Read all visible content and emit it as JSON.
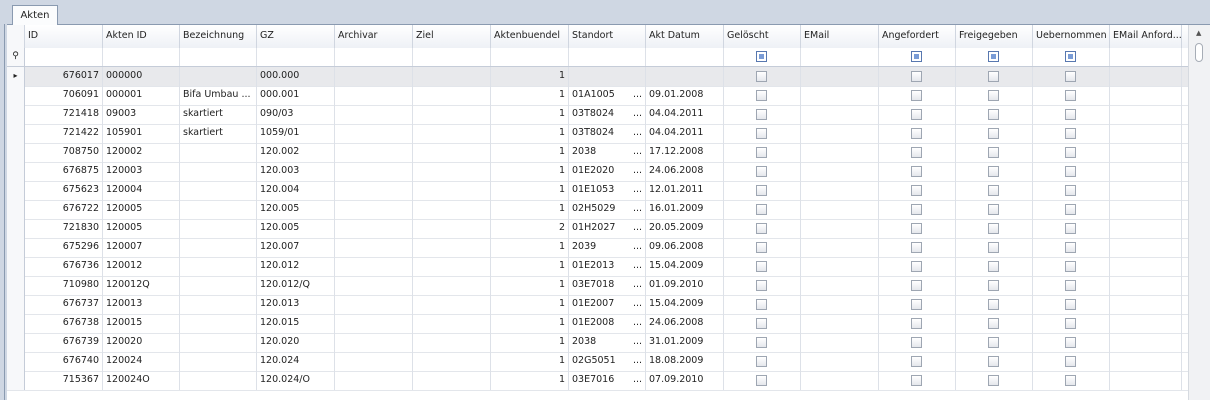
{
  "tab": {
    "label": "Akten"
  },
  "columns": [
    "ID",
    "Akten ID",
    "Bezeichnung",
    "GZ",
    "Archivar",
    "Ziel",
    "Aktenbuendel",
    "Standort",
    "Akt Datum",
    "Gelöscht",
    "EMail",
    "Angefordert",
    "Freigegeben",
    "Uebernommen",
    "EMail Anford..."
  ],
  "rows": [
    {
      "id": "676017",
      "akten_id": "000000",
      "bezeichnung": "",
      "gz": "000.000",
      "buendel": "1",
      "standort": "",
      "datum": ""
    },
    {
      "id": "706091",
      "akten_id": "000001",
      "bezeichnung": "Bifa Umbau ...",
      "gz": "000.001",
      "buendel": "1",
      "standort": "01A1005",
      "datum": "09.01.2008"
    },
    {
      "id": "721418",
      "akten_id": "09003",
      "bezeichnung": "skartiert",
      "gz": "090/03",
      "buendel": "1",
      "standort": "03T8024",
      "datum": "04.04.2011"
    },
    {
      "id": "721422",
      "akten_id": "105901",
      "bezeichnung": "skartiert",
      "gz": "1059/01",
      "buendel": "1",
      "standort": "03T8024",
      "datum": "04.04.2011"
    },
    {
      "id": "708750",
      "akten_id": "120002",
      "bezeichnung": "",
      "gz": "120.002",
      "buendel": "1",
      "standort": "2038",
      "datum": "17.12.2008"
    },
    {
      "id": "676875",
      "akten_id": "120003",
      "bezeichnung": "",
      "gz": "120.003",
      "buendel": "1",
      "standort": "01E2020",
      "datum": "24.06.2008"
    },
    {
      "id": "675623",
      "akten_id": "120004",
      "bezeichnung": "",
      "gz": "120.004",
      "buendel": "1",
      "standort": "01E1053",
      "datum": "12.01.2011"
    },
    {
      "id": "676722",
      "akten_id": "120005",
      "bezeichnung": "",
      "gz": "120.005",
      "buendel": "1",
      "standort": "02H5029",
      "datum": "16.01.2009"
    },
    {
      "id": "721830",
      "akten_id": "120005",
      "bezeichnung": "",
      "gz": "120.005",
      "buendel": "2",
      "standort": "01H2027",
      "datum": "20.05.2009"
    },
    {
      "id": "675296",
      "akten_id": "120007",
      "bezeichnung": "",
      "gz": "120.007",
      "buendel": "1",
      "standort": "2039",
      "datum": "09.06.2008"
    },
    {
      "id": "676736",
      "akten_id": "120012",
      "bezeichnung": "",
      "gz": "120.012",
      "buendel": "1",
      "standort": "01E2013",
      "datum": "15.04.2009"
    },
    {
      "id": "710980",
      "akten_id": "120012Q",
      "bezeichnung": "",
      "gz": "120.012/Q",
      "buendel": "1",
      "standort": "03E7018",
      "datum": "01.09.2010"
    },
    {
      "id": "676737",
      "akten_id": "120013",
      "bezeichnung": "",
      "gz": "120.013",
      "buendel": "1",
      "standort": "01E2007",
      "datum": "15.04.2009"
    },
    {
      "id": "676738",
      "akten_id": "120015",
      "bezeichnung": "",
      "gz": "120.015",
      "buendel": "1",
      "standort": "01E2008",
      "datum": "24.06.2008"
    },
    {
      "id": "676739",
      "akten_id": "120020",
      "bezeichnung": "",
      "gz": "120.020",
      "buendel": "1",
      "standort": "2038",
      "datum": "31.01.2009"
    },
    {
      "id": "676740",
      "akten_id": "120024",
      "bezeichnung": "",
      "gz": "120.024",
      "buendel": "1",
      "standort": "02G5051",
      "datum": "18.08.2009"
    },
    {
      "id": "715367",
      "akten_id": "120024O",
      "bezeichnung": "",
      "gz": "120.024/O",
      "buendel": "1",
      "standort": "03E7016",
      "datum": "07.09.2010"
    }
  ],
  "ellipsis": "...",
  "row_indicator": "▸",
  "filter_indicator": "⚲",
  "scroll_up": "▲",
  "colors": {
    "grid_bg": "#ffffff",
    "header_bg": "#eef1f6",
    "selected_row": "#e8e9ec",
    "checkbox_indeterminate": "#7a9cd6"
  }
}
